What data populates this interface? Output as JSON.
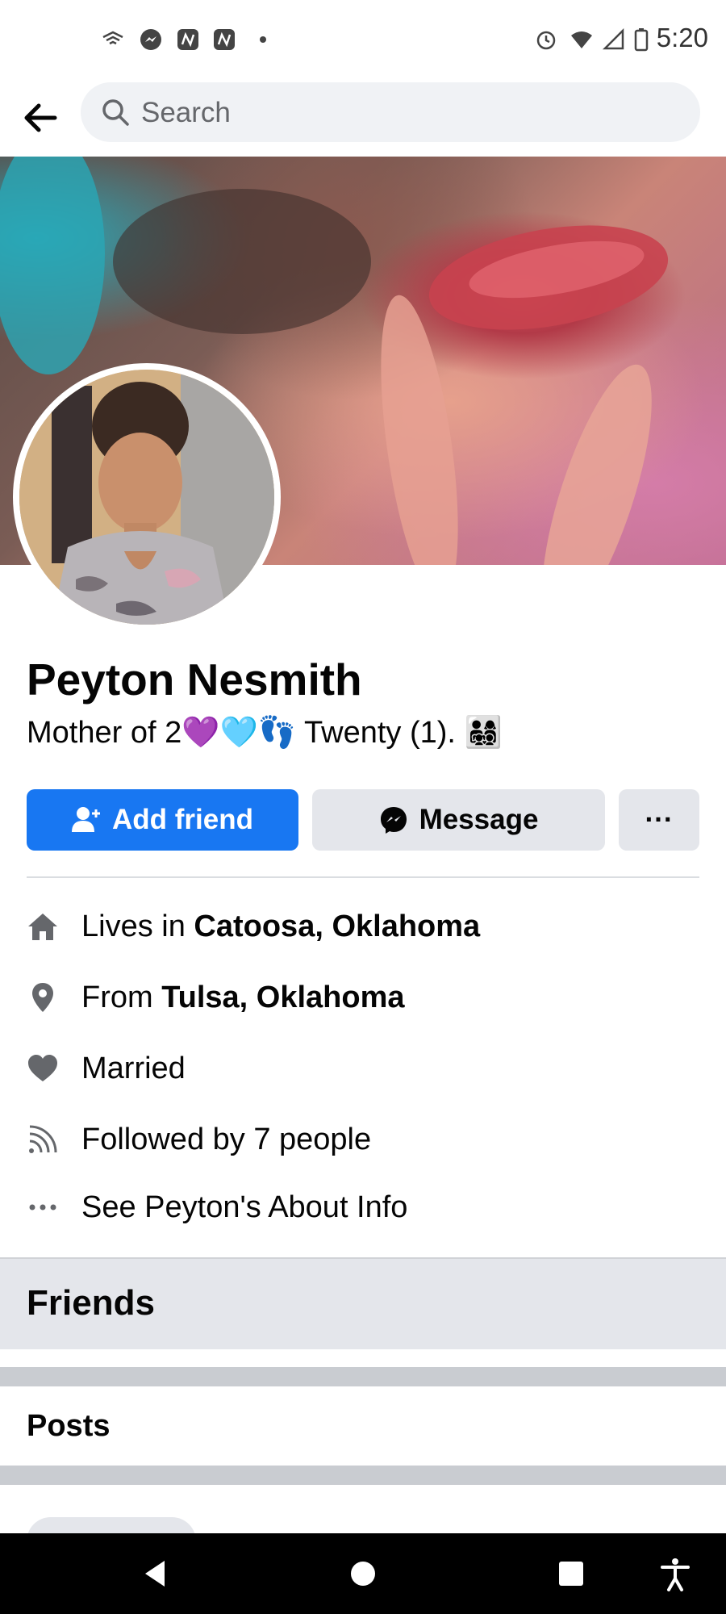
{
  "status_bar": {
    "time": "5:20",
    "icons": [
      "wifi-calling-icon",
      "messenger-icon",
      "app-icon",
      "app-icon",
      "dot-icon",
      "alarm-icon",
      "wifi-icon",
      "signal-icon",
      "battery-icon"
    ]
  },
  "topbar": {
    "search_placeholder": "Search"
  },
  "profile": {
    "name": "Peyton Nesmith",
    "bio": "Mother of 2💜🩵👣 Twenty (1). 👨‍👩‍👧‍👦"
  },
  "actions": {
    "add_friend": "Add friend",
    "message": "Message",
    "more": "···"
  },
  "info": {
    "lives_prefix": "Lives in ",
    "lives_place": "Catoosa, Oklahoma",
    "from_prefix": "From ",
    "from_place": "Tulsa, Oklahoma",
    "relationship": "Married",
    "followers": "Followed by 7 people",
    "about": "See Peyton's About Info"
  },
  "sections": {
    "friends": "Friends",
    "posts": "Posts"
  },
  "colors": {
    "primary": "#1877f2",
    "button_gray": "#e4e6eb",
    "icon_gray": "#65676b"
  }
}
